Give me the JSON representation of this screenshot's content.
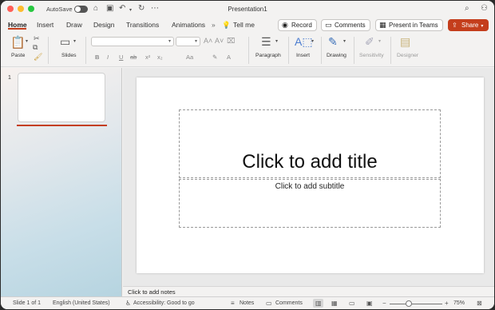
{
  "window": {
    "title": "Presentation1",
    "autosave_label": "AutoSave",
    "traffic_lights": [
      "#ff5f57",
      "#febc2e",
      "#28c840"
    ]
  },
  "tabs": [
    {
      "label": "Home",
      "active": true
    },
    {
      "label": "Insert"
    },
    {
      "label": "Draw"
    },
    {
      "label": "Design"
    },
    {
      "label": "Transitions"
    },
    {
      "label": "Animations"
    }
  ],
  "tell_me": "Tell me",
  "right_buttons": {
    "record": "Record",
    "comments": "Comments",
    "present": "Present in Teams",
    "share": "Share"
  },
  "ribbon": {
    "paste": "Paste",
    "slides": "Slides",
    "paragraph": "Paragraph",
    "insert": "Insert",
    "drawing": "Drawing",
    "sensitivity": "Sensitivity",
    "designer": "Designer",
    "format_buttons": [
      "B",
      "I",
      "U",
      "ab",
      "x²",
      "x₂",
      "Aa"
    ]
  },
  "slide_panel": {
    "slide_number": "1"
  },
  "slide": {
    "title_placeholder": "Click to add title",
    "subtitle_placeholder": "Click to add subtitle"
  },
  "notes_placeholder": "Click to add notes",
  "status": {
    "slide_of": "Slide 1 of 1",
    "language": "English (United States)",
    "accessibility": "Accessibility: Good to go",
    "notes": "Notes",
    "comments": "Comments",
    "zoom": "75%"
  },
  "colors": {
    "accent": "#c43e1c"
  }
}
